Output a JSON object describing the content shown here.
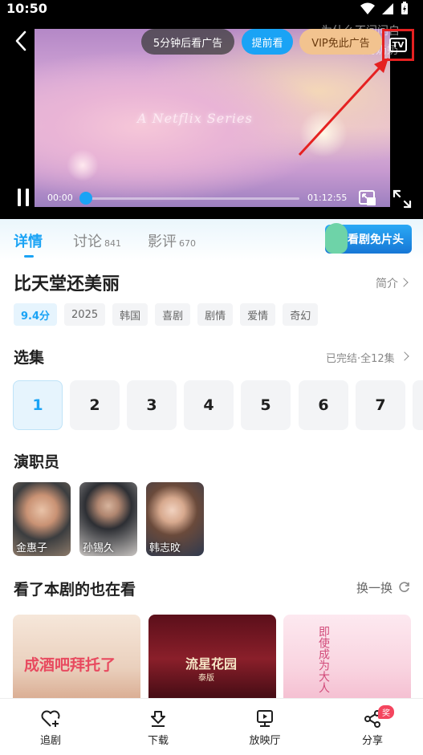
{
  "status_bar": {
    "time": "10:50"
  },
  "player": {
    "ad_countdown": "5分钟后看广告",
    "watch_ahead": "提前看",
    "vip_no_ads": "VIP免此广告",
    "tv_label": "TV",
    "video_overlay_text": "A Netflix Series",
    "bg_text_line1": "为什么不问问自",
    "bg_text_line2": "蛋奶奶奶",
    "current_time": "00:00",
    "duration": "01:12:55",
    "progress": 0.0
  },
  "tabs": [
    {
      "label": "详情",
      "count": ""
    },
    {
      "label": "讨论",
      "count": "841"
    },
    {
      "label": "影评",
      "count": "670"
    }
  ],
  "promo": {
    "label": "看剧免片头"
  },
  "show": {
    "title": "比天堂还美丽",
    "intro_label": "简介",
    "tags": [
      "9.4分",
      "2025",
      "韩国",
      "喜剧",
      "剧情",
      "爱情",
      "奇幻"
    ]
  },
  "episodes": {
    "title": "选集",
    "status": "已完结·全12集",
    "items": [
      "1",
      "2",
      "3",
      "4",
      "5",
      "6",
      "7"
    ]
  },
  "cast": {
    "title": "演职员",
    "members": [
      {
        "name": "金惠子"
      },
      {
        "name": "孙锡久"
      },
      {
        "name": "韩志旼"
      }
    ]
  },
  "recommendations": {
    "title": "看了本剧的也在看",
    "refresh": "换一换",
    "items": [
      {
        "overlay": "成酒吧拜托了",
        "subtitle": ""
      },
      {
        "overlay": "流星花园",
        "subtitle": "泰版"
      },
      {
        "overlay": "即使成为大人",
        "subtitle": ""
      }
    ]
  },
  "bottom_nav": [
    {
      "label": "追剧",
      "icon": "heart-plus-icon"
    },
    {
      "label": "下载",
      "icon": "download-icon"
    },
    {
      "label": "放映厅",
      "icon": "screen-icon"
    },
    {
      "label": "分享",
      "icon": "share-icon"
    }
  ],
  "share_badge": "奖",
  "colors": {
    "accent": "#1aa3f5",
    "highlight_border": "#e52121",
    "vip": "#f2c38f",
    "badge": "#f4455e"
  }
}
